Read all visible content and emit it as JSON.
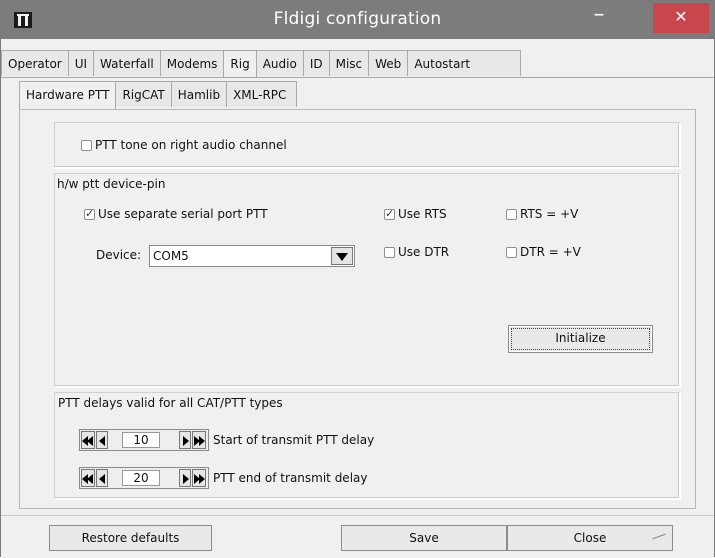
{
  "window": {
    "title": "Fldigi configuration",
    "minimize_glyph": "–",
    "close_glyph": "✕",
    "app_icon": "fldigi-app-icon"
  },
  "tabs": [
    {
      "label": "Operator",
      "active": false
    },
    {
      "label": "UI",
      "active": false
    },
    {
      "label": "Waterfall",
      "active": false
    },
    {
      "label": "Modems",
      "active": false
    },
    {
      "label": "Rig",
      "active": true
    },
    {
      "label": "Audio",
      "active": false
    },
    {
      "label": "ID",
      "active": false
    },
    {
      "label": "Misc",
      "active": false
    },
    {
      "label": "Web",
      "active": false
    },
    {
      "label": "Autostart",
      "active": false
    }
  ],
  "subtabs": [
    {
      "label": "Hardware PTT",
      "active": true
    },
    {
      "label": "RigCAT",
      "active": false
    },
    {
      "label": "Hamlib",
      "active": false
    },
    {
      "label": "XML-RPC",
      "active": false
    }
  ],
  "ptt_tone": {
    "label": "PTT tone on right audio channel",
    "checked": false
  },
  "hw_group": {
    "title": "h/w ptt device-pin",
    "use_separate": {
      "label": "Use separate serial port PTT",
      "checked": true
    },
    "use_rts": {
      "label": "Use RTS",
      "checked": true
    },
    "rts_pos": {
      "label": "RTS = +V",
      "checked": false
    },
    "use_dtr": {
      "label": "Use DTR",
      "checked": false
    },
    "dtr_pos": {
      "label": "DTR = +V",
      "checked": false
    },
    "device_label": "Device:",
    "device_value": "COM5",
    "initialize": "Initialize"
  },
  "delays": {
    "title": "PTT delays valid for all CAT/PTT types",
    "start": {
      "value": "10",
      "label": "Start of transmit PTT delay"
    },
    "end": {
      "value": "20",
      "label": "PTT end of transmit delay"
    }
  },
  "footer": {
    "restore": "Restore defaults",
    "save": "Save",
    "close": "Close"
  }
}
